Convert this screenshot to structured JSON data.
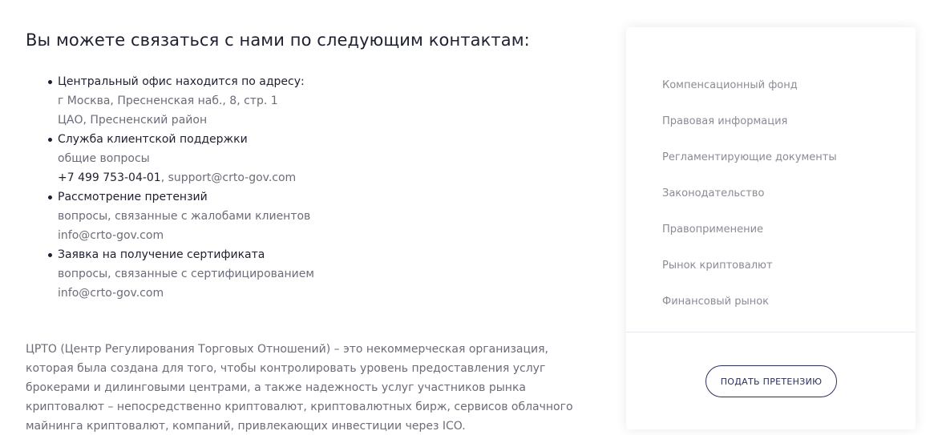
{
  "main": {
    "heading": "Вы можете связаться с нами по следующим контактам:",
    "contacts": [
      {
        "title": "Центральный офис находится по адресу:",
        "lines": [
          "г Москва, Пресненская наб., 8, стр. 1",
          "ЦАО, Пресненский район"
        ]
      },
      {
        "title": "Служба клиентской поддержки",
        "lines": [
          "общие вопросы"
        ],
        "phone": "+7 499 753-04-01",
        "email": ", support@crto-gov.com"
      },
      {
        "title": "Рассмотрение претензий",
        "lines": [
          "вопросы, связанные с жалобами клиентов",
          "info@crto-gov.com"
        ]
      },
      {
        "title": "Заявка на получение сертификата",
        "lines": [
          "вопросы, связанные с сертифицированием",
          "info@crto-gov.com"
        ]
      }
    ],
    "about": [
      "ЦРТО (Центр Регулирования Торговых Отношений) – это некоммерческая организация,",
      "которая была создана для того, чтобы контролировать уровень предоставления услуг",
      "брокерами и дилинговыми центрами, а также надежность услуг участников рынка",
      "криптовалют – непосредственно криптовалют, криптовалютных бирж, сервисов облачного",
      "майнинга криптовалют, компаний, привлекающих инвестиции через ICO."
    ]
  },
  "sidebar": {
    "items": [
      "Компенсационный фонд",
      "Правовая информация",
      "Регламентирующие документы",
      "Законодательство",
      "Правоприменение",
      "Рынок криптовалют",
      "Финансовый рынок"
    ],
    "claim_button": "ПОДАТЬ ПРЕТЕНЗИЮ"
  },
  "colors": {
    "heading": "#1e2030",
    "muted_text": "#6b6d78",
    "sidebar_link": "#8a8c96",
    "button_border": "#2b2f5a"
  }
}
